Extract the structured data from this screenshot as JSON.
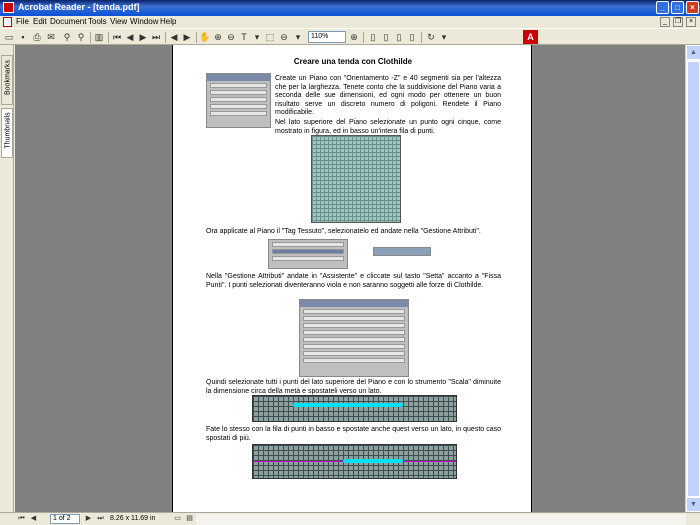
{
  "window": {
    "title": "Acrobat Reader - [tenda.pdf]"
  },
  "menu": [
    "File",
    "Edit",
    "Document",
    "Tools",
    "View",
    "Window",
    "Help"
  ],
  "toolbar": {
    "zoom": "110%"
  },
  "nav_tabs": [
    "Thumbnails",
    "Bookmarks"
  ],
  "status": {
    "page": "1 of 2",
    "size": "8.26 x 11.69 in"
  },
  "document": {
    "title": "Creare una tenda con Clothilde",
    "p1": "Create un Piano con \"Orientamento -Z\" e 40 segmenti sia per l'altezza che per la larghezza. Tenete conto che la suddivisione del Piano varia a seconda delle sue dimensioni, ed ogni modo per ottenere un buon risultato serve un discreto numero di poligoni. Rendete il Piano modificabile.",
    "p2": "Nel lato superiore del Piano selezionate un punto ogni cinque, come mostrato in figura, ed in basso un'intera fila di punti.",
    "p3": "Ora applicate al Piano il \"Tag Tessuto\", selezionatelo ed andate nella \"Gestione Attributi\".",
    "p4": "Nella \"Gestione Attributi\" andate in \"Assistente\" e cliccate sul tasto \"Setta\" accanto a \"Fissa Punti\". I punti selezionati diventeranno viola e non saranno soggetti alle forze di Clothilde.",
    "p5": "Quindi selezionate tutti i punti del lato superiore del Piano e con lo strumento \"Scala\" diminuite la dimensione circa della metà e spostateli verso un lato.",
    "p6": "Fate lo stesso con la fila di punti in basso e spostate anche quest verso un lato, in questo caso spostati di più."
  }
}
